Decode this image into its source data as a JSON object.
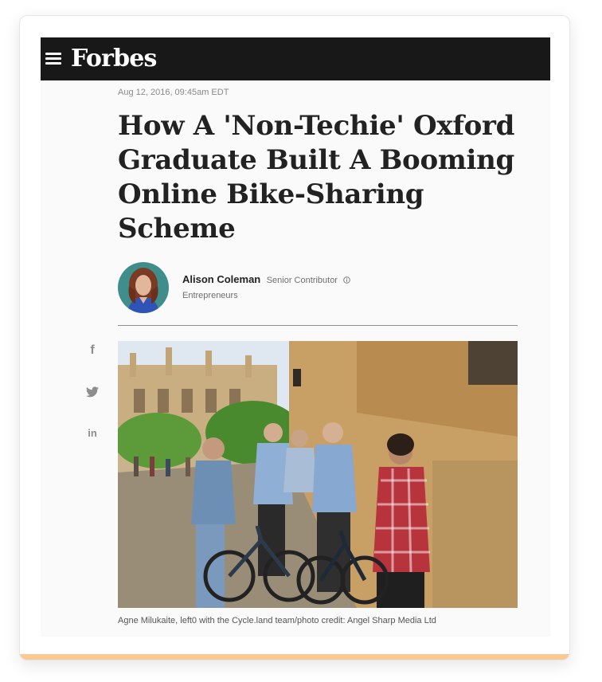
{
  "brand": {
    "logo_text": "Forbes",
    "topbar_color": "#181818",
    "accent_color": "#f9c98f"
  },
  "icons": {
    "menu": "hamburger-menu-icon",
    "facebook": "facebook-icon",
    "twitter": "twitter-icon",
    "linkedin": "linkedin-icon",
    "info": "info-icon"
  },
  "article": {
    "date": "Aug 12, 2016, 09:45am EDT",
    "headline": "How A 'Non-Techie' Oxford Graduate Built A Booming Online Bike-Sharing Scheme",
    "author": {
      "name": "Alison Coleman",
      "role": "Senior Contributor",
      "section": "Entrepreneurs"
    },
    "image_caption": "Agne Milukaite, left0 with the Cycle.land team/photo credit: Angel Sharp Media Ltd"
  },
  "social": {
    "facebook_glyph": "f",
    "linkedin_glyph": "in"
  }
}
